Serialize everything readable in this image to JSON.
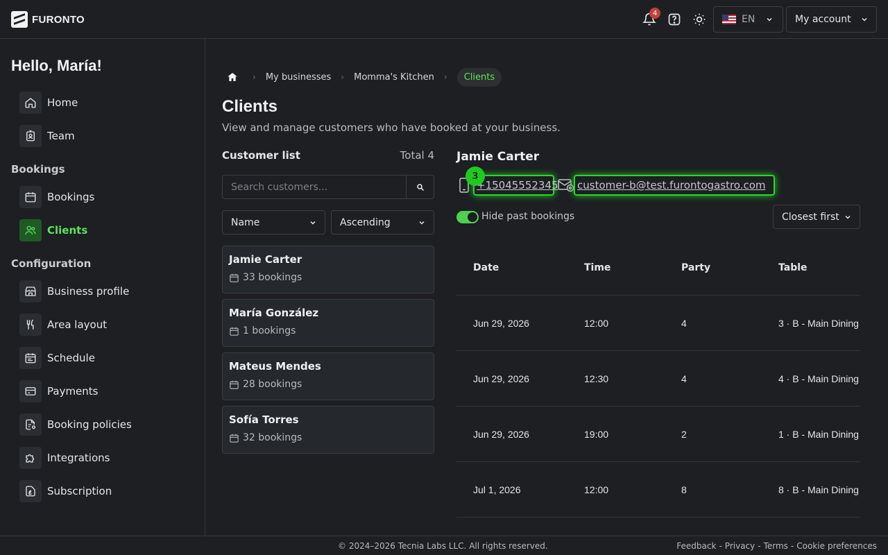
{
  "brand": {
    "name": "FURONTO"
  },
  "topbar": {
    "notification_count": "4",
    "language": "EN",
    "account_label": "My account"
  },
  "sidebar": {
    "greeting": "Hello, María!",
    "items_top": [
      {
        "label": "Home",
        "icon": "home-icon"
      },
      {
        "label": "Team",
        "icon": "badge-icon"
      }
    ],
    "bookings_title": "Bookings",
    "items_bookings": [
      {
        "label": "Bookings",
        "icon": "calendar-icon"
      },
      {
        "label": "Clients",
        "icon": "users-icon",
        "active": true
      }
    ],
    "config_title": "Configuration",
    "items_config": [
      {
        "label": "Business profile",
        "icon": "store-icon"
      },
      {
        "label": "Area layout",
        "icon": "utensils-icon"
      },
      {
        "label": "Schedule",
        "icon": "schedule-icon"
      },
      {
        "label": "Payments",
        "icon": "card-icon"
      },
      {
        "label": "Booking policies",
        "icon": "policy-icon"
      },
      {
        "label": "Integrations",
        "icon": "puzzle-icon"
      },
      {
        "label": "Subscription",
        "icon": "subscription-icon"
      }
    ]
  },
  "breadcrumb": {
    "items": [
      "My businesses",
      "Momma's Kitchen"
    ],
    "current": "Clients"
  },
  "page": {
    "title": "Clients",
    "description": "View and manage customers who have booked at your business."
  },
  "customer_list": {
    "title": "Customer list",
    "total": "Total 4",
    "search_placeholder": "Search customers...",
    "sort_field": "Name",
    "sort_order": "Ascending",
    "customers": [
      {
        "name": "Jamie Carter",
        "bookings": "33 bookings"
      },
      {
        "name": "María González",
        "bookings": "1 bookings"
      },
      {
        "name": "Mateus Mendes",
        "bookings": "28 bookings"
      },
      {
        "name": "Sofía Torres",
        "bookings": "32 bookings"
      }
    ]
  },
  "detail": {
    "name": "Jamie Carter",
    "step_badge": "3",
    "phone": "+15045552345",
    "email": "customer-b@test.furontogastro.com",
    "hide_past_label": "Hide past bookings",
    "hide_past_on": true,
    "sort_label": "Closest first",
    "table": {
      "headers": [
        "Date",
        "Time",
        "Party",
        "Table"
      ],
      "rows": [
        [
          "Jun 29, 2026",
          "12:00",
          "4",
          "3 · B - Main Dining"
        ],
        [
          "Jun 29, 2026",
          "12:30",
          "4",
          "4 · B - Main Dining"
        ],
        [
          "Jun 29, 2026",
          "19:00",
          "2",
          "1 · B - Main Dining"
        ],
        [
          "Jul 1, 2026",
          "12:00",
          "8",
          "8 · B - Main Dining"
        ]
      ]
    }
  },
  "footer": {
    "copyright": "© 2024–2026 Tecnia Labs LLC. All rights reserved.",
    "links": [
      "Feedback",
      "Privacy",
      "Terms",
      "Cookie preferences"
    ]
  },
  "colors": {
    "accent": "#5be35b",
    "highlight": "#2bd62b",
    "badge": "#c2413b"
  }
}
